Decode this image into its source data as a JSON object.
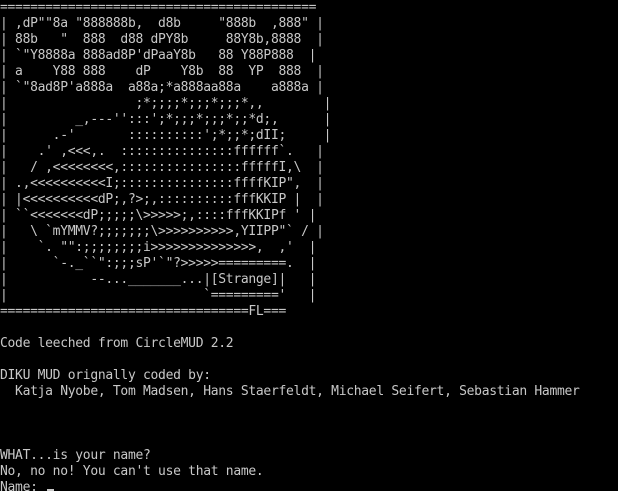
{
  "banner": {
    "art_lines": [
      "==========================================",
      "| ,dP\"\"8a \"888888b,  d8b     \"888b  ,888\" |",
      "| 88b   \"  888  d88 dPY8b     88Y8b,8888  |",
      "| `\"Y8888a 888ad8P'dPaaY8b   88 Y88P888  |",
      "| a    Y88 888    dP    Y8b  88  YP  888  |",
      "| `\"8ad8P'a888a  a88a;*a888aa88a    a888a |",
      "|                 ;*;;;;*;;;*;;;*,,        |",
      "|         _,---'':::';*;;;*;;;*;;*d;,      |",
      "|      .-'       ::::::::::';*;;*;dII;     |",
      "|    .' ,<<<,.  :::::::::::::::ffffff`.   |",
      "|   / ,<<<<<<<<,::::::::::::::::fffffI,\\  |",
      "| .,<<<<<<<<<<I;:::::::::::::::ffffKIP\",  |",
      "| |<<<<<<<<<<dP;,?>;,::::::::::fffKKIP |  |",
      "| ``<<<<<<<dP;;;;;\\>>>>>;,::::fffKKIPf ' |",
      "|   \\ `mYMMV?;;;;;;;\\>>>>>>>>>>,YIIPP\"` / |",
      "|    `. \"\":;;;;;;;;i>>>>>>>>>>>>>>,  ,'  |",
      "|      `-._``\":;;;sP'`\"?>>>>>=========.  |",
      "|           --..._______...|[Strange]|   |",
      "|                          `========='   |",
      "=================================FL==="
    ]
  },
  "messages": {
    "leeched": "Code leeched from CircleMUD 2.2",
    "diku_heading": "DIKU MUD orignally coded by:",
    "diku_authors": "  Katja Nyobe, Tom Madsen, Hans Staerfeldt, Michael Seifert, Sebastian Hammer",
    "name_question": "WHAT...is your name?",
    "name_rejected": "No, no no! You can't use that name.",
    "name_prompt": "Name: "
  },
  "colors": {
    "background": "#000000",
    "text": "#c8c8c8"
  }
}
